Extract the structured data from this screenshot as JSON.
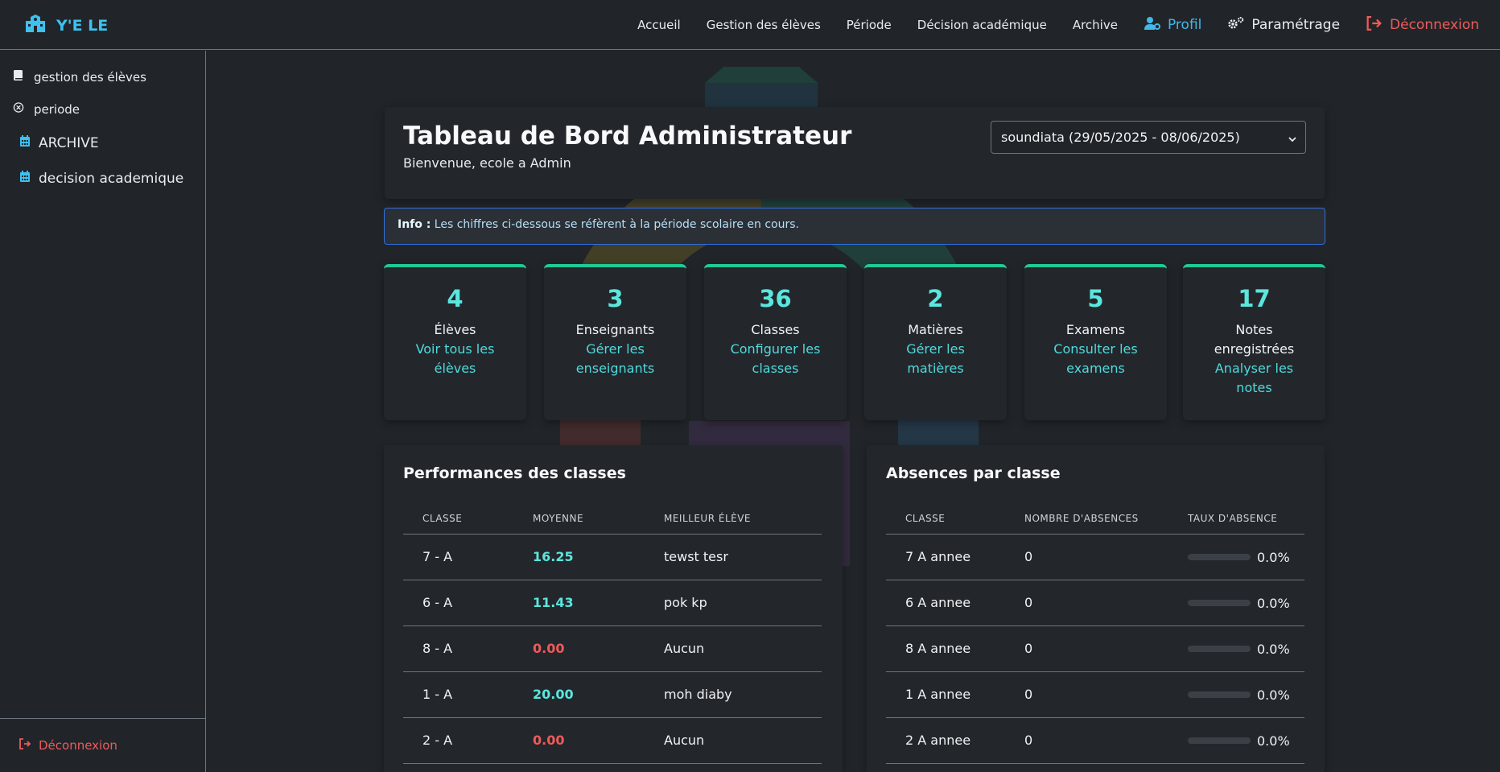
{
  "brand": {
    "name": "Y'E LE"
  },
  "nav": {
    "accueil": "Accueil",
    "gestion_eleves": "Gestion des élèves",
    "periode": "Période",
    "decision": "Décision académique",
    "archive": "Archive",
    "profil": "Profil",
    "parametrage": "Paramétrage",
    "deconnexion": "Déconnexion"
  },
  "sidebar": {
    "items": [
      {
        "label": "gestion des élèves",
        "icon": "book-icon"
      },
      {
        "label": "periode",
        "icon": "circle-x-icon"
      },
      {
        "label": "ARCHIVE",
        "icon": "calendar-icon"
      },
      {
        "label": "decision academique",
        "icon": "calendar-icon"
      }
    ],
    "logout": "Déconnexion"
  },
  "header": {
    "title": "Tableau de Bord Administrateur",
    "subtitle": "Bienvenue, ecole a Admin",
    "period_selected": "soundiata (29/05/2025 - 08/06/2025)"
  },
  "info": {
    "label": "Info :",
    "text": " Les chiffres ci-dessous se réfèrent à la période scolaire en cours."
  },
  "stats": [
    {
      "value": "4",
      "label": "Élèves",
      "link": "Voir tous les élèves"
    },
    {
      "value": "3",
      "label": "Enseignants",
      "link": "Gérer les enseignants"
    },
    {
      "value": "36",
      "label": "Classes",
      "link": "Configurer les classes"
    },
    {
      "value": "2",
      "label": "Matières",
      "link": "Gérer les matières"
    },
    {
      "value": "5",
      "label": "Examens",
      "link": "Consulter les examens"
    },
    {
      "value": "17",
      "label": "Notes enregistrées",
      "link": "Analyser les notes"
    }
  ],
  "performances": {
    "title": "Performances des classes",
    "headers": [
      "CLASSE",
      "MOYENNE",
      "MEILLEUR ÉLÈVE"
    ],
    "rows": [
      {
        "classe": "7 - A",
        "moyenne": "16.25",
        "eleve": "tewst tesr",
        "status": "good"
      },
      {
        "classe": "6 - A",
        "moyenne": "11.43",
        "eleve": "pok kp",
        "status": "good"
      },
      {
        "classe": "8 - A",
        "moyenne": "0.00",
        "eleve": "Aucun",
        "status": "bad"
      },
      {
        "classe": "1 - A",
        "moyenne": "20.00",
        "eleve": "moh diaby",
        "status": "good"
      },
      {
        "classe": "2 - A",
        "moyenne": "0.00",
        "eleve": "Aucun",
        "status": "bad"
      }
    ]
  },
  "absences": {
    "title": "Absences par classe",
    "headers": [
      "CLASSE",
      "NOMBRE D'ABSENCES",
      "TAUX D'ABSENCE"
    ],
    "rows": [
      {
        "classe": "7 A annee",
        "nombre": "0",
        "taux": "0.0%",
        "taux_fraction": 0
      },
      {
        "classe": "6 A annee",
        "nombre": "0",
        "taux": "0.0%",
        "taux_fraction": 0
      },
      {
        "classe": "8 A annee",
        "nombre": "0",
        "taux": "0.0%",
        "taux_fraction": 0
      },
      {
        "classe": "1 A annee",
        "nombre": "0",
        "taux": "0.0%",
        "taux_fraction": 0
      },
      {
        "classe": "2 A annee",
        "nombre": "0",
        "taux": "0.0%",
        "taux_fraction": 0
      }
    ]
  },
  "colors": {
    "accent": "#20c997",
    "stat_value": "#5be6de",
    "danger": "#ef5a5a",
    "info_border": "#2f6fe0",
    "profil": "#42b8ea"
  }
}
